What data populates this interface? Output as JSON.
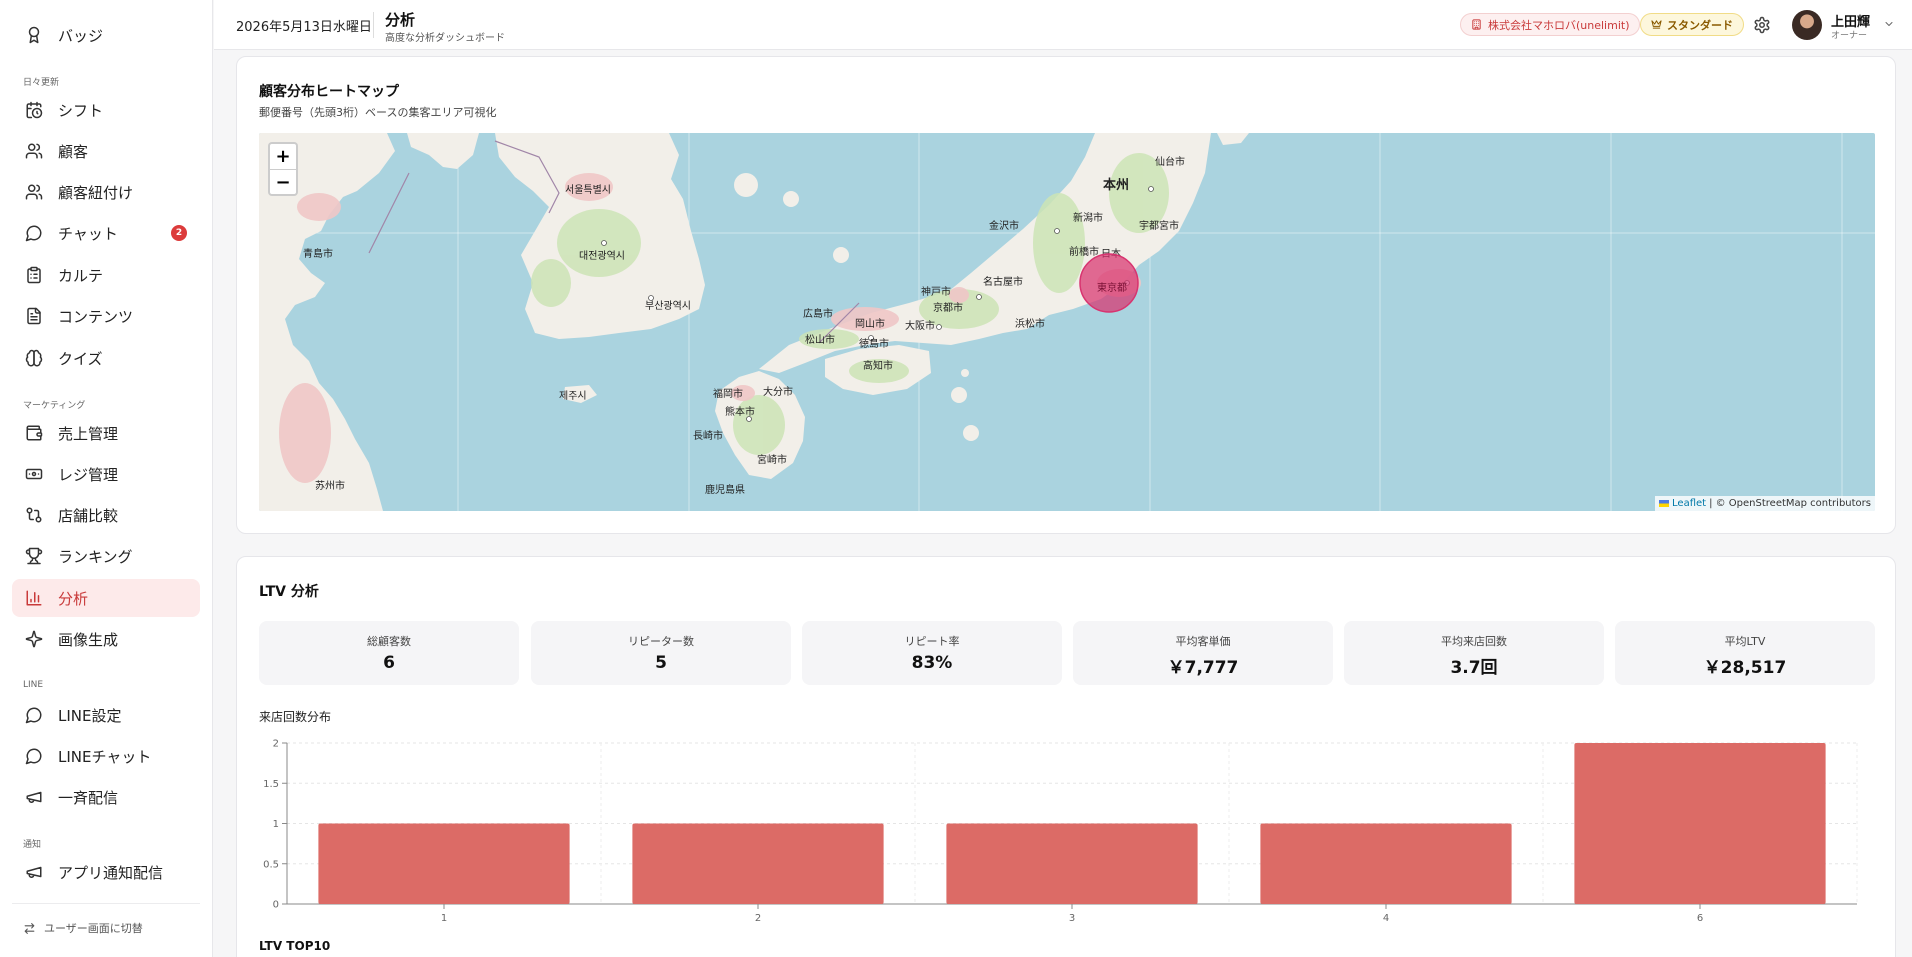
{
  "header": {
    "date": "2026年5月13日水曜日",
    "title": "分析",
    "subtitle": "高度な分析ダッシュボード",
    "company": "株式会社マホロバ(unelimit)",
    "plan": "スタンダード",
    "user_name": "上田輝",
    "user_role": "オーナー"
  },
  "sidebar": {
    "sections": {
      "daily": "日々更新",
      "marketing": "マーケティング",
      "line": "LINE",
      "notify": "通知"
    },
    "items": [
      {
        "label": "バッジ",
        "icon": "badge-icon"
      },
      {
        "label": "シフト",
        "icon": "calendar-clock-icon"
      },
      {
        "label": "顧客",
        "icon": "users-icon"
      },
      {
        "label": "顧客紐付け",
        "icon": "user-link-icon"
      },
      {
        "label": "チャット",
        "icon": "chat-icon",
        "badge": "2"
      },
      {
        "label": "カルテ",
        "icon": "clipboard-icon"
      },
      {
        "label": "コンテンツ",
        "icon": "document-icon"
      },
      {
        "label": "クイズ",
        "icon": "brain-icon"
      },
      {
        "label": "売上管理",
        "icon": "wallet-icon"
      },
      {
        "label": "レジ管理",
        "icon": "register-icon"
      },
      {
        "label": "店舗比較",
        "icon": "compare-icon"
      },
      {
        "label": "ランキング",
        "icon": "trophy-icon"
      },
      {
        "label": "分析",
        "icon": "bar-chart-icon",
        "active": true
      },
      {
        "label": "画像生成",
        "icon": "sparkle-icon"
      },
      {
        "label": "LINE設定",
        "icon": "chat-icon"
      },
      {
        "label": "LINEチャット",
        "icon": "chat-icon"
      },
      {
        "label": "一斉配信",
        "icon": "megaphone-icon"
      },
      {
        "label": "アプリ通知配信",
        "icon": "megaphone-icon"
      }
    ],
    "switch_label": "ユーザー画面に切替"
  },
  "heatmap": {
    "title": "顧客分布ヒートマップ",
    "subtitle": "郵便番号（先頭3桁）ベースの集客エリア可視化",
    "zoom_in": "+",
    "zoom_out": "−",
    "attribution_leaflet": "Leaflet",
    "attribution_osm": "| © OpenStreetMap contributors",
    "labels": {
      "honshu": "本州",
      "tokyo": "東京都",
      "nagoya": "名古屋市",
      "osaka": "大阪市",
      "kyoto": "京都市",
      "hiroshima": "広島市",
      "fukuoka": "福岡市",
      "seoul": "서울특별시",
      "daejeon": "대전광역시",
      "busan": "부산광역시",
      "kagoshima": "鹿児島県",
      "niigata": "新潟市",
      "sendai": "仙台市",
      "kanazawa": "金沢市",
      "utsunomiya": "宇都宮市",
      "maebashi": "前橋市",
      "hamamatsu": "浜松市",
      "okayama": "岡山市",
      "kobe": "神戸市",
      "kochi": "高知市",
      "kumamoto": "熊本市",
      "nagasaki": "長崎市",
      "miyazaki": "宮崎市",
      "oita": "大分市",
      "matsuyama": "松山市",
      "tokushima": "徳島市",
      "shanghai": "苏州市",
      "jeju": "제주시",
      "qingdao": "青島市",
      "nihon": "日本"
    },
    "marker": {
      "label": "東京都",
      "color": "#d8336f"
    }
  },
  "ltv": {
    "title": "LTV 分析",
    "stats": [
      {
        "label": "総顧客数",
        "value": "6"
      },
      {
        "label": "リピーター数",
        "value": "5"
      },
      {
        "label": "リピート率",
        "value": "83%"
      },
      {
        "label": "平均客単価",
        "value": "￥7,777"
      },
      {
        "label": "平均来店回数",
        "value": "3.7回"
      },
      {
        "label": "平均LTV",
        "value": "￥28,517"
      }
    ],
    "chart_title": "来店回数分布",
    "top10_title": "LTV TOP10"
  },
  "chart_data": {
    "type": "bar",
    "categories": [
      "1",
      "2",
      "3",
      "4",
      "6"
    ],
    "values": [
      1,
      1,
      1,
      1,
      2
    ],
    "ylim": [
      0,
      2
    ],
    "yticks": [
      "0",
      "0.5",
      "1",
      "1.5",
      "2"
    ],
    "bar_color": "#dc6b66",
    "grid": true
  }
}
